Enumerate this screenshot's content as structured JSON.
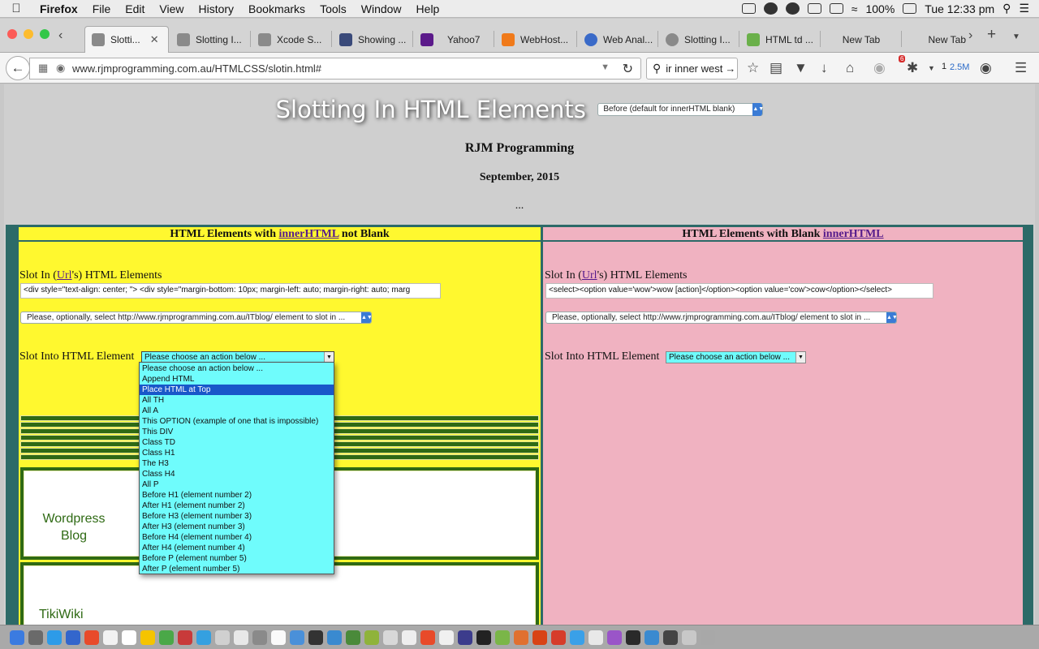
{
  "menubar": {
    "app_name": "Firefox",
    "items": [
      "File",
      "Edit",
      "View",
      "History",
      "Bookmarks",
      "Tools",
      "Window",
      "Help"
    ],
    "battery": "100%",
    "clock": "Tue 12:33 pm"
  },
  "tabs": [
    {
      "label": "Slotti...",
      "active": true,
      "fav_color": "#8a8a8a"
    },
    {
      "label": "Slotting I...",
      "fav_color": "#8a8a8a"
    },
    {
      "label": "Xcode S...",
      "fav_color": "#8a8a8a"
    },
    {
      "label": "Showing ...",
      "fav_color": "#3a4a7a"
    },
    {
      "label": "Yahoo7",
      "fav_color": "#5b1a8a"
    },
    {
      "label": "WebHost...",
      "fav_color": "#f07a1a"
    },
    {
      "label": "Web Anal...",
      "fav_color": "#3a6ac8"
    },
    {
      "label": "Slotting I...",
      "fav_color": "#8a8a8a"
    },
    {
      "label": "HTML td ...",
      "fav_color": "#6ab04a"
    },
    {
      "label": "New Tab",
      "fav_color": ""
    },
    {
      "label": "New Tab",
      "fav_color": ""
    }
  ],
  "navbar": {
    "url": "www.rjmprogramming.com.au/HTMLCSS/slotin.html#",
    "search_value": "ir inner west",
    "badge_count": "6",
    "download_count": "1",
    "download_size": "2.5M"
  },
  "page": {
    "title": "Slotting In HTML Elements",
    "position_select": "Before (default for innerHTML blank)",
    "author": "RJM Programming",
    "date": "September, 2015",
    "ellipsis": "...",
    "left": {
      "header_prefix": "HTML Elements with ",
      "header_link": "innerHTML",
      "header_suffix": " not Blank",
      "slot_label_prefix": "Slot In (",
      "slot_label_link": "Url",
      "slot_label_suffix": "'s) HTML Elements",
      "html_input": "    <div style=\"text-align: center; \">     <div style=\"margin-bottom: 10px; margin-left: auto; margin-right: auto; marg",
      "element_select": "Please, optionally, select http://www.rjmprogramming.com.au/ITblog/ element to slot in ...",
      "slot_into_label": "Slot Into HTML Element",
      "action_select": "Please choose an action below ...",
      "blog1": "Wordpress Blog",
      "blog2": "TikiWiki"
    },
    "right": {
      "header_prefix": "HTML Elements with Blank ",
      "header_link": "innerHTML",
      "slot_label_prefix": "Slot In (",
      "slot_label_link": "Url",
      "slot_label_suffix": "'s) HTML Elements",
      "html_input": "<select><option value='wow'>wow [action]</option><option value='cow'>cow</option></select>",
      "element_select": "Please, optionally, select http://www.rjmprogramming.com.au/ITblog/ element to slot in ...",
      "slot_into_label": "Slot Into HTML Element",
      "action_select": "Please choose an action below ..."
    },
    "dropdown_options": [
      "Please choose an action below ...",
      "Append HTML",
      "Place HTML at Top",
      "All TH",
      "All A",
      "This OPTION (example of one that is impossible)",
      "This DIV",
      "Class TD",
      "Class H1",
      "The H3",
      "Class H4",
      "All P",
      "Before H1 (element number 2)",
      "After H1 (element number 2)",
      "Before H3 (element number 3)",
      "After H3 (element number 3)",
      "Before H4 (element number 4)",
      "After H4 (element number 4)",
      "Before P (element number 5)",
      "After P (element number 5)"
    ],
    "dropdown_highlighted": "Place HTML at Top"
  },
  "dock_colors": [
    "#3b7be0",
    "#6a6a6a",
    "#2d9be8",
    "#3366cc",
    "#e84a2a",
    "#f2f2f2",
    "#ffffff",
    "#f5c400",
    "#4aa848",
    "#c83a3a",
    "#35a0e0",
    "#d0d0d0",
    "#e8e8e8",
    "#8a8a8a",
    "#fafafa",
    "#4a90d9",
    "#333333",
    "#3a8ad0",
    "#4a8a3a",
    "#8fb33a",
    "#d8d8d8",
    "#eeeeee",
    "#e84a2a",
    "#f0f0f0",
    "#3c3c8c",
    "#222222",
    "#7ab648",
    "#e07030",
    "#d84315",
    "#d63c2a",
    "#3aa0e8",
    "#e8e8e8",
    "#9a55c8",
    "#2a2a2a",
    "#3a8ad0",
    "#444444",
    "#c8c8c8",
    "#a8a8a8"
  ]
}
